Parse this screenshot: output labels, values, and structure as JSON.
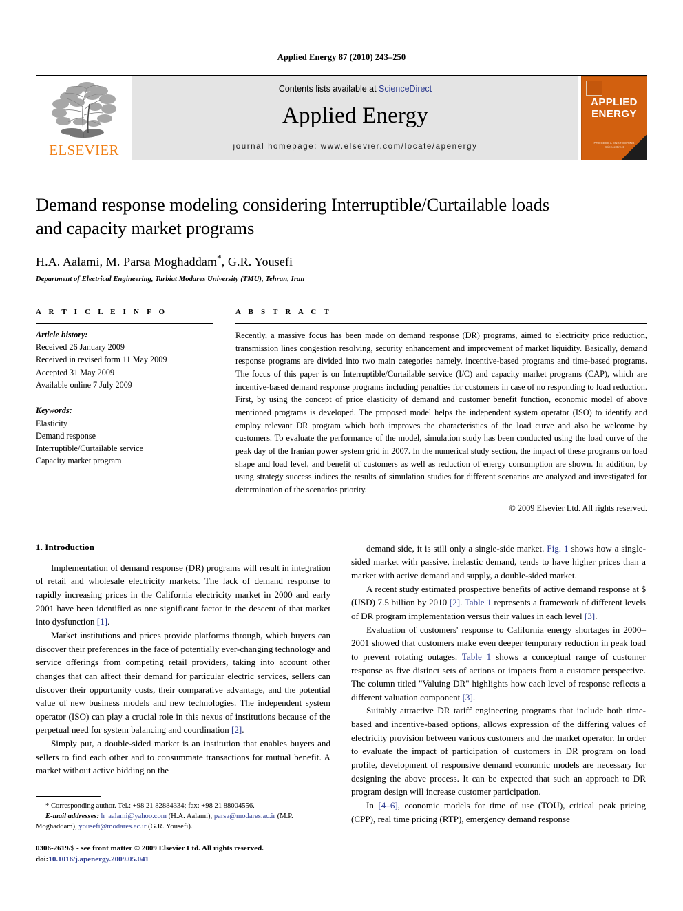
{
  "running_head": "Applied Energy 87 (2010) 243–250",
  "masthead": {
    "publisher_name": "ELSEVIER",
    "contents_prefix": "Contents lists available at ",
    "contents_link": "ScienceDirect",
    "journal_name": "Applied Energy",
    "homepage": "journal homepage: www.elsevier.com/locate/apenergy",
    "cover_title_line1": "APPLIED",
    "cover_title_line2": "ENERGY",
    "cover_footer_line1": "PROCESS & ENGINEERING",
    "cover_footer_line2": "ScienceDirect"
  },
  "article": {
    "title_line1": "Demand response modeling considering Interruptible/Curtailable loads",
    "title_line2": "and capacity market programs",
    "authors": "H.A. Aalami, M. Parsa Moghaddam",
    "corresponding_marker": "*",
    "authors_tail": ", G.R. Yousefi",
    "affiliation": "Department of Electrical Engineering, Tarbiat Modares University (TMU), Tehran, Iran"
  },
  "article_info": {
    "label": "A R T I C L E    I N F O",
    "history_heading": "Article history:",
    "history": [
      "Received 26 January 2009",
      "Received in revised form 11 May 2009",
      "Accepted 31 May 2009",
      "Available online 7 July 2009"
    ],
    "keywords_heading": "Keywords:",
    "keywords": [
      "Elasticity",
      "Demand response",
      "Interruptible/Curtailable service",
      "Capacity market program"
    ]
  },
  "abstract": {
    "label": "A B S T R A C T",
    "text": "Recently, a massive focus has been made on demand response (DR) programs, aimed to electricity price reduction, transmission lines congestion resolving, security enhancement and improvement of market liquidity. Basically, demand response programs are divided into two main categories namely, incentive-based programs and time-based programs. The focus of this paper is on Interruptible/Curtailable service (I/C) and capacity market programs (CAP), which are incentive-based demand response programs including penalties for customers in case of no responding to load reduction. First, by using the concept of price elasticity of demand and customer benefit function, economic model of above mentioned programs is developed. The proposed model helps the independent system operator (ISO) to identify and employ relevant DR program which both improves the characteristics of the load curve and also be welcome by customers. To evaluate the performance of the model, simulation study has been conducted using the load curve of the peak day of the Iranian power system grid in 2007. In the numerical study section, the impact of these programs on load shape and load level, and benefit of customers as well as reduction of energy consumption are shown. In addition, by using strategy success indices the results of simulation studies for different scenarios are analyzed and investigated for determination of the scenarios priority.",
    "copyright": "© 2009 Elsevier Ltd. All rights reserved."
  },
  "introduction": {
    "heading": "1. Introduction",
    "left_paragraphs": [
      {
        "parts": [
          {
            "t": "Implementation of demand response (DR) programs will result in integration of retail and wholesale electricity markets. The lack of demand response to rapidly increasing prices in the California electricity market in 2000 and early 2001 have been identified as one significant factor in the descent of that market into dysfunction ",
            "link": false
          },
          {
            "t": "[1]",
            "link": true
          },
          {
            "t": ".",
            "link": false
          }
        ]
      },
      {
        "parts": [
          {
            "t": "Market institutions and prices provide platforms through, which buyers can discover their preferences in the face of potentially ever-changing technology and service offerings from competing retail providers, taking into account other changes that can affect their demand for particular electric services, sellers can discover their opportunity costs, their comparative advantage, and the potential value of new business models and new technologies. The independent system operator (ISO) can play a crucial role in this nexus of institutions because of the perpetual need for system balancing and coordination ",
            "link": false
          },
          {
            "t": "[2]",
            "link": true
          },
          {
            "t": ".",
            "link": false
          }
        ]
      },
      {
        "parts": [
          {
            "t": "Simply put, a double-sided market is an institution that enables buyers and sellers to find each other and to consummate transactions for mutual benefit. A market without active bidding on the",
            "link": false
          }
        ]
      }
    ],
    "right_paragraphs": [
      {
        "parts": [
          {
            "t": "demand side, it is still only a single-side market. ",
            "link": false
          },
          {
            "t": "Fig. 1",
            "link": true
          },
          {
            "t": " shows how a single-sided market with passive, inelastic demand, tends to have higher prices than a market with active demand and supply, a double-sided market.",
            "link": false
          }
        ]
      },
      {
        "parts": [
          {
            "t": "A recent study estimated prospective benefits of active demand response at $ (USD) 7.5 billion by 2010 ",
            "link": false
          },
          {
            "t": "[2]",
            "link": true
          },
          {
            "t": ". ",
            "link": false
          },
          {
            "t": "Table 1",
            "link": true
          },
          {
            "t": " represents a framework of different levels of DR program implementation versus their values in each level ",
            "link": false
          },
          {
            "t": "[3]",
            "link": true
          },
          {
            "t": ".",
            "link": false
          }
        ]
      },
      {
        "parts": [
          {
            "t": "Evaluation of customers' response to California energy shortages in 2000–2001 showed that customers make even deeper temporary reduction in peak load to prevent rotating outages. ",
            "link": false
          },
          {
            "t": "Table 1",
            "link": true
          },
          {
            "t": " shows a conceptual range of customer response as five distinct sets of actions or impacts from a customer perspective. The column titled \"Valuing DR\" highlights how each level of response reflects a different valuation component ",
            "link": false
          },
          {
            "t": "[3]",
            "link": true
          },
          {
            "t": ".",
            "link": false
          }
        ]
      },
      {
        "parts": [
          {
            "t": "Suitably attractive DR tariff engineering programs that include both time-based and incentive-based options, allows expression of the differing values of electricity provision between various customers and the market operator. In order to evaluate the impact of participation of customers in DR program on load profile, development of responsive demand economic models are necessary for designing the above process. It can be expected that such an approach to DR program design will increase customer participation.",
            "link": false
          }
        ]
      },
      {
        "parts": [
          {
            "t": "In ",
            "link": false
          },
          {
            "t": "[4–6]",
            "link": true
          },
          {
            "t": ", economic models for time of use (TOU), critical peak pricing (CPP), real time pricing (RTP), emergency demand response",
            "link": false
          }
        ]
      }
    ]
  },
  "footnotes": {
    "corresponding": "* Corresponding author. Tel.: +98 21 82884334; fax: +98 21 88004556.",
    "email_label": "E-mail addresses:",
    "emails": [
      {
        "address": "h_aalami@yahoo.com",
        "owner": " (H.A. Aalami), "
      },
      {
        "address": "parsa@modares.ac.ir",
        "owner": " (M.P. Moghaddam), "
      },
      {
        "address": "yousefi@modares.ac.ir",
        "owner": " (G.R. Yousefi)."
      }
    ],
    "imprint_line1": "0306-2619/$ - see front matter © 2009 Elsevier Ltd. All rights reserved.",
    "doi_label": "doi:",
    "doi_value": "10.1016/j.apenergy.2009.05.041"
  },
  "colors": {
    "elsevier_orange": "#F07E13",
    "cover_orange": "#D2600F",
    "link_blue": "#2B3A8F",
    "masthead_grey": "#e4e4e4"
  }
}
